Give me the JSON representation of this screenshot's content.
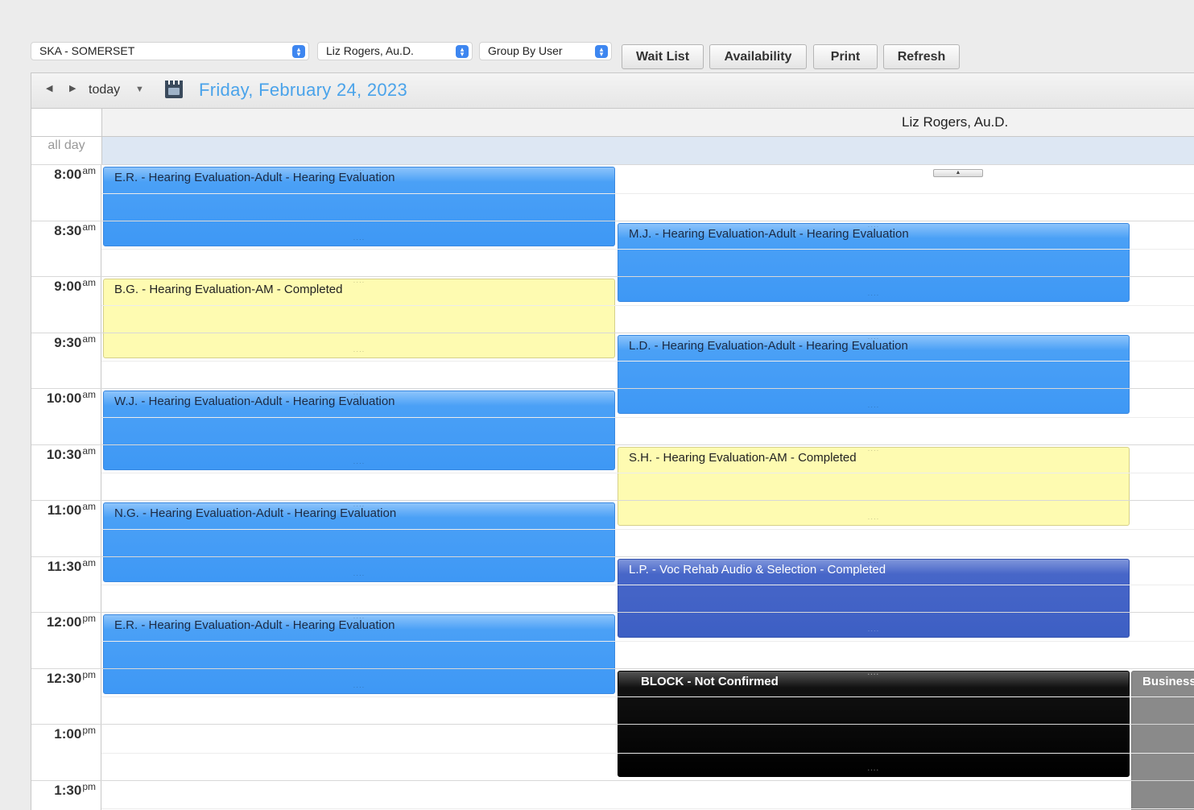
{
  "toolbar": {
    "location_select": "SKA - SOMERSET",
    "provider_select": "Liz Rogers, Au.D.",
    "group_select": "Group By User",
    "buttons": {
      "wait_list": "Wait List",
      "availability": "Availability",
      "print": "Print",
      "refresh": "Refresh"
    }
  },
  "calendar": {
    "today_label": "today",
    "date_title": "Friday, February 24, 2023",
    "column_header": "Liz Rogers, Au.D.",
    "all_day_label": "all day",
    "times": [
      {
        "time": "8:00",
        "period": "am"
      },
      {
        "time": "8:30",
        "period": "am"
      },
      {
        "time": "9:00",
        "period": "am"
      },
      {
        "time": "9:30",
        "period": "am"
      },
      {
        "time": "10:00",
        "period": "am"
      },
      {
        "time": "10:30",
        "period": "am"
      },
      {
        "time": "11:00",
        "period": "am"
      },
      {
        "time": "11:30",
        "period": "am"
      },
      {
        "time": "12:00",
        "period": "pm"
      },
      {
        "time": "12:30",
        "period": "pm"
      },
      {
        "time": "1:00",
        "period": "pm"
      },
      {
        "time": "1:30",
        "period": "pm"
      }
    ],
    "events": [
      {
        "title": "E.R. - Hearing Evaluation-Adult - Hearing Evaluation",
        "type": "blue"
      },
      {
        "title": "B.G. - Hearing Evaluation-AM - Completed",
        "type": "yellow"
      },
      {
        "title": "W.J. - Hearing Evaluation-Adult - Hearing Evaluation",
        "type": "blue"
      },
      {
        "title": "N.G. - Hearing Evaluation-Adult - Hearing Evaluation",
        "type": "blue"
      },
      {
        "title": "E.R. - Hearing Evaluation-Adult - Hearing Evaluation",
        "type": "blue"
      },
      {
        "title": "M.J. - Hearing Evaluation-Adult - Hearing Evaluation",
        "type": "blue"
      },
      {
        "title": "L.D. - Hearing Evaluation-Adult - Hearing Evaluation",
        "type": "blue"
      },
      {
        "title": "S.H. - Hearing Evaluation-AM - Completed",
        "type": "yellow"
      },
      {
        "title": "L.P. - Voc Rehab Audio & Selection - Completed",
        "type": "darkblue"
      },
      {
        "title": "BLOCK - Not Confirmed",
        "type": "black"
      },
      {
        "title": "Business",
        "type": "gray"
      }
    ]
  },
  "colors": {
    "date_title": "#4aa3ea",
    "appointment_blue": "#3e98f5",
    "completed_yellow": "#fefbb1",
    "voc_rehab_blue": "#3d5fc4",
    "block_black": "#000000",
    "business_gray": "#8a8a8a",
    "select_accent": "#3d86f0"
  },
  "icons": [
    "prev-arrow-icon",
    "next-arrow-icon",
    "dropdown-caret-icon",
    "calendar-picker-icon",
    "scroll-up-icon"
  ]
}
